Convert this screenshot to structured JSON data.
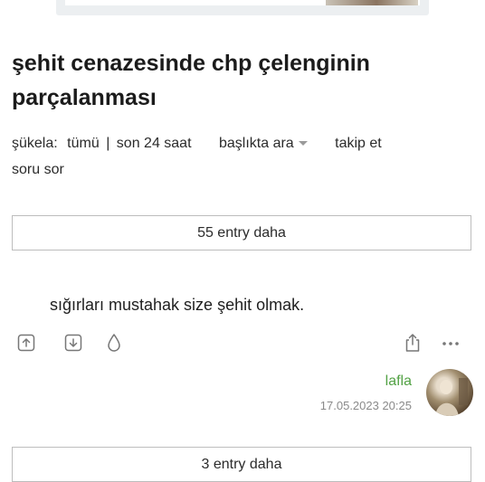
{
  "topic": {
    "title": "şehit cenazesinde chp çelenginin parçalanması"
  },
  "meta": {
    "sukela_label": "şükela:",
    "filter_all": "tümü",
    "separator": "|",
    "filter_24h": "son 24 saat",
    "search_in_title": "başlıkta ara",
    "follow": "takip et",
    "ask_question": "soru sor"
  },
  "more_entries_top": "55 entry daha",
  "entry": {
    "text": "sığırları mustahak size şehit olmak.",
    "author": "lafla",
    "date": "17.05.2023 20:25"
  },
  "more_entries_bottom": "3 entry daha",
  "icons": {
    "upvote": "upvote-icon",
    "downvote": "downvote-icon",
    "favorite": "drop-icon",
    "share": "share-icon",
    "more": "more-dots-icon"
  }
}
